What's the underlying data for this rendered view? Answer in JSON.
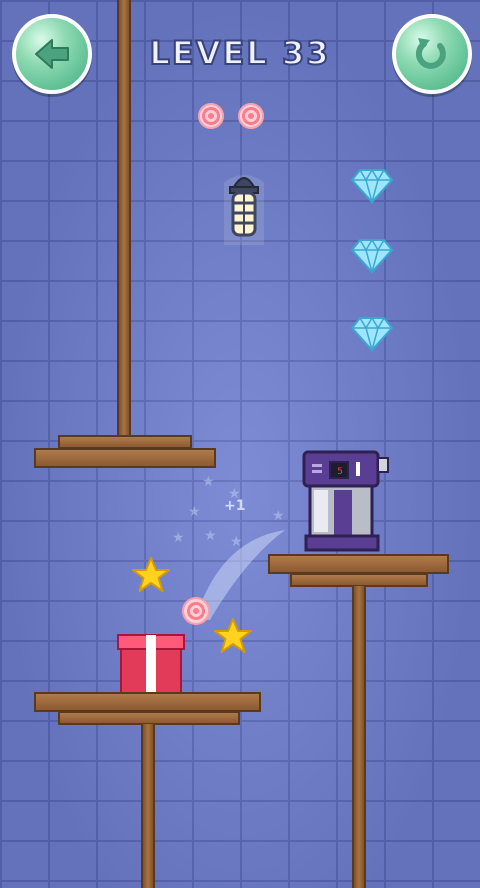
{
  "level": {
    "label": "LEVEL 33"
  },
  "hud": {
    "back_icon": "arrow-left-icon",
    "restart_icon": "restart-icon",
    "candies_remaining": 2,
    "candy_icon": "candy-swirl-icon"
  },
  "effects": {
    "score_popup": "+1"
  },
  "items": {
    "diamonds": 3,
    "stars": 2,
    "gift_box": "gift-box-icon",
    "lamp": "lantern-icon",
    "machine": "candy-machine-icon",
    "machine_display": "5"
  },
  "colors": {
    "background": "#6f7fd1",
    "button_green": "#5dbf93",
    "gift_red": "#e23b5a",
    "machine_purple": "#5a3e94",
    "wood": "#a06b3d",
    "star_yellow": "#ffd21f",
    "diamond_cyan": "#8fe3ff"
  }
}
